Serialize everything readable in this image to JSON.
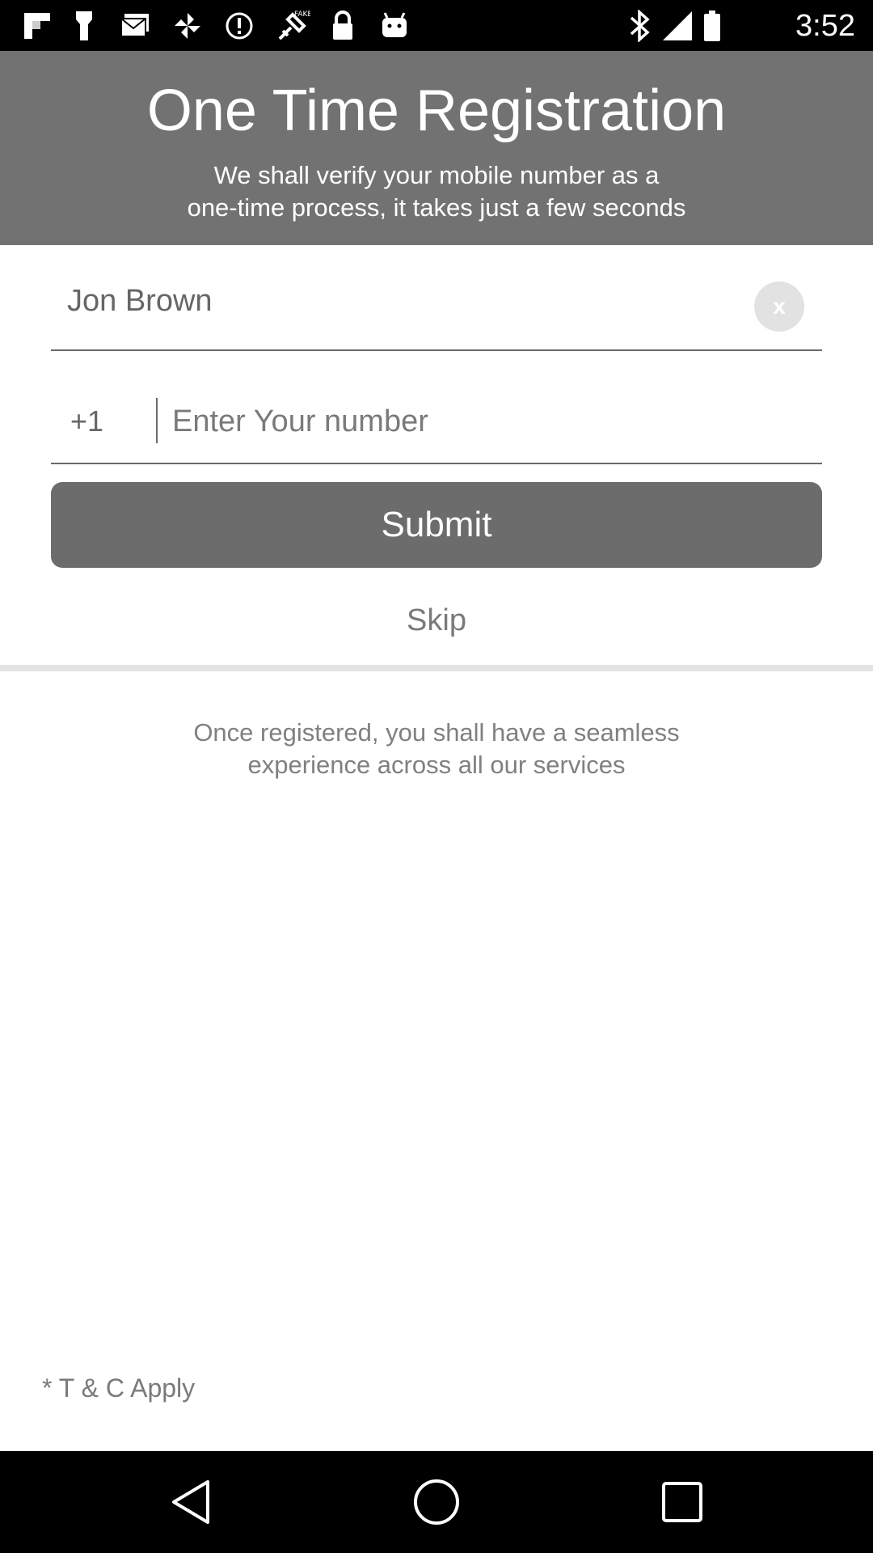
{
  "status_bar": {
    "time": "3:52",
    "icons": [
      "flipboard-icon",
      "flashlight-icon",
      "mail-icon",
      "pinwheel-icon",
      "info-icon",
      "fake-gps-icon",
      "lock-icon",
      "android-icon",
      "bluetooth-icon",
      "signal-icon",
      "battery-icon"
    ]
  },
  "header": {
    "title": "One Time Registration",
    "subtitle_line1": "We shall verify your mobile number as a",
    "subtitle_line2": "one-time process, it takes just a few seconds"
  },
  "form": {
    "name_value": "Jon Brown",
    "clear_label": "x",
    "country_code": "+1",
    "phone_placeholder": "Enter Your number",
    "submit_label": "Submit",
    "skip_label": "Skip"
  },
  "info": {
    "line1": "Once registered, you shall have a seamless",
    "line2": "experience across all our services"
  },
  "footer": {
    "terms": "* T & C Apply"
  },
  "colors": {
    "header_bg": "#727272",
    "button_bg": "#6c6c6c",
    "status_bar_bg": "#000000"
  }
}
